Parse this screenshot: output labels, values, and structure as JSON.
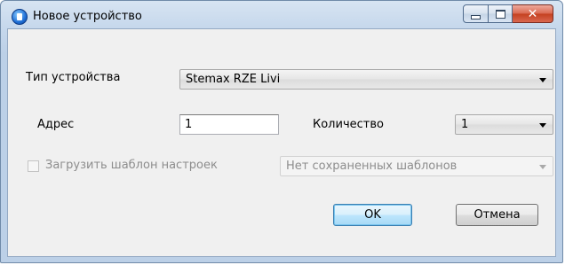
{
  "window": {
    "title": "Новое устройство"
  },
  "caption_buttons": {
    "minimize_icon": "minimize-icon",
    "maximize_icon": "maximize-icon",
    "close_glyph": "✕"
  },
  "form": {
    "device_type": {
      "label": "Тип устройства",
      "value": "Stemax RZE Livi"
    },
    "address": {
      "label": "Адрес",
      "value": "1"
    },
    "quantity": {
      "label": "Количество",
      "value": "1"
    },
    "load_template": {
      "label": "Загрузить шаблон настроек",
      "checked": false,
      "enabled": false
    },
    "template_select": {
      "value": "Нет сохраненных шаблонов",
      "enabled": false
    }
  },
  "buttons": {
    "ok": "OK",
    "cancel": "Отмена"
  },
  "colors": {
    "title_bar": "#c6d8ec",
    "close_button": "#c4401f",
    "client_bg": "#f0f0f0",
    "default_button_border": "#3c7fb1"
  }
}
